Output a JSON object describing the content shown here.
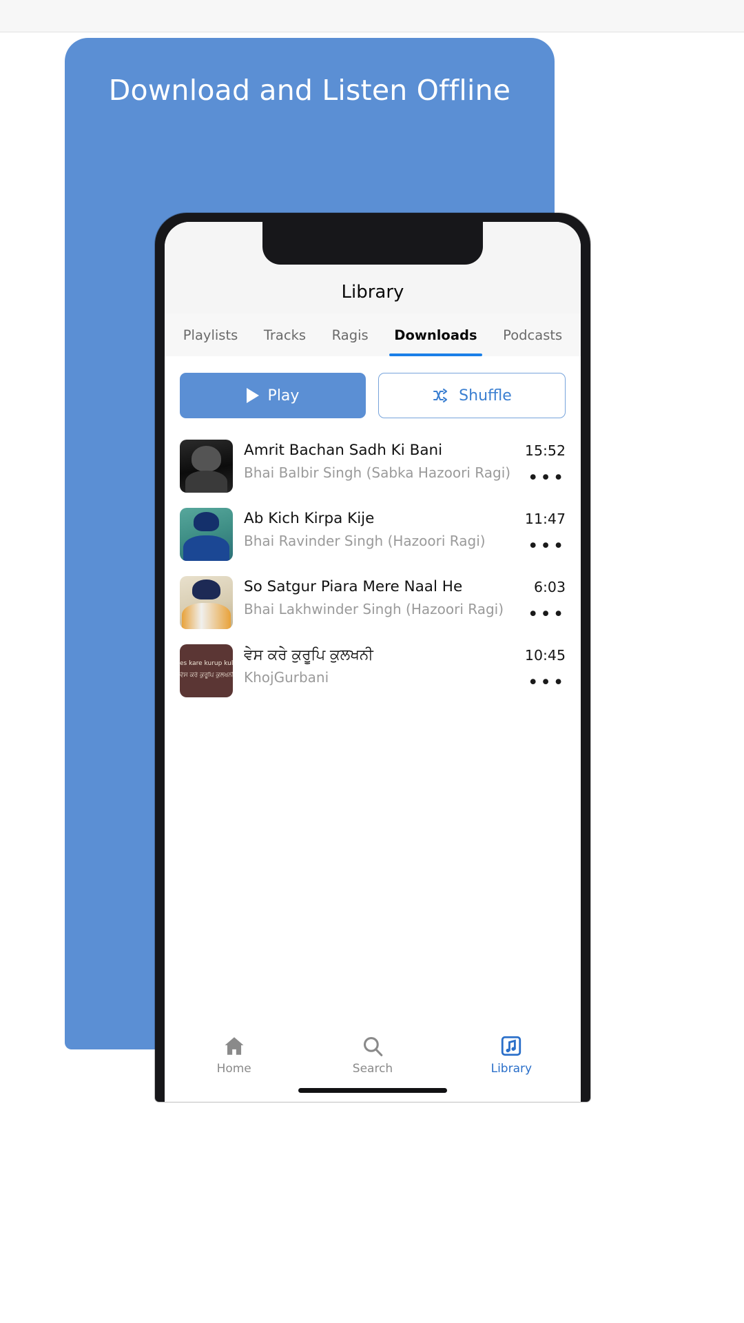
{
  "promo": {
    "headline": "Download and Listen Offline",
    "bg_color": "#5b8fd4"
  },
  "phone": {
    "header": {
      "title": "Library"
    },
    "tabs": [
      {
        "label": "Playlists",
        "active": false
      },
      {
        "label": "Tracks",
        "active": false
      },
      {
        "label": "Ragis",
        "active": false
      },
      {
        "label": "Downloads",
        "active": true
      },
      {
        "label": "Podcasts",
        "active": false
      }
    ],
    "actions": {
      "play_label": "Play",
      "play_icon": "play-triangle-icon",
      "shuffle_label": "Shuffle",
      "shuffle_icon": "shuffle-icon",
      "accent_color": "#5b8fd4",
      "outline_color": "#3b7fd1"
    },
    "tracks": [
      {
        "title": "Amrit Bachan Sadh Ki Bani",
        "artist": "Bhai Balbir Singh (Sabka Hazoori Ragi)",
        "duration": "15:52",
        "more": "•••",
        "art": "art1",
        "art_caption": ""
      },
      {
        "title": "Ab Kich Kirpa Kije",
        "artist": "Bhai Ravinder Singh (Hazoori Ragi)",
        "duration": "11:47",
        "more": "•••",
        "art": "art2",
        "art_caption": ""
      },
      {
        "title": "So Satgur Piara Mere Naal He",
        "artist": "Bhai Lakhwinder Singh (Hazoori Ragi)",
        "duration": "6:03",
        "more": "•••",
        "art": "art3",
        "art_caption": ""
      },
      {
        "title": "ਵੇਸ ਕਰੇ ਕੁਰੂਪਿ ਕੁਲਖਨੀ",
        "artist": "KhojGurbani",
        "duration": "10:45",
        "more": "•••",
        "art": "art4",
        "art_caption": "es kare kurup kulakha",
        "art_caption2": "ਵੇਸ ਕਰੇ ਕੁਰੂਪਿ ਕੁਲਖਨੀ"
      }
    ],
    "bottom_nav": [
      {
        "label": "Home",
        "icon": "home-icon",
        "active": false
      },
      {
        "label": "Search",
        "icon": "search-icon",
        "active": false
      },
      {
        "label": "Library",
        "icon": "library-music-icon",
        "active": true
      }
    ]
  }
}
